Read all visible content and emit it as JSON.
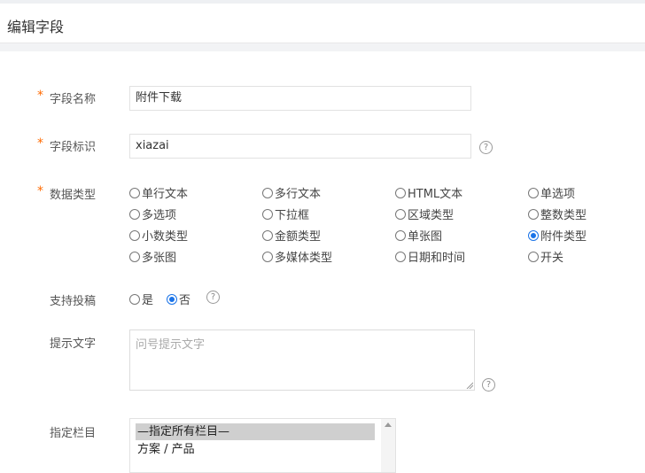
{
  "header": {
    "title": "编辑字段"
  },
  "form": {
    "required_mark": "*",
    "field_name": {
      "label": "字段名称",
      "value": "附件下载"
    },
    "field_key": {
      "label": "字段标识",
      "value": "xiazai"
    },
    "data_type": {
      "label": "数据类型",
      "options": [
        "单行文本",
        "多行文本",
        "HTML文本",
        "单选项",
        "多选项",
        "下拉框",
        "区域类型",
        "整数类型",
        "小数类型",
        "金额类型",
        "单张图",
        "附件类型",
        "多张图",
        "多媒体类型",
        "日期和时间",
        "开关"
      ],
      "selected": "附件类型"
    },
    "allow_submit": {
      "label": "支持投稿",
      "yes": "是",
      "no": "否",
      "selected": "否"
    },
    "hint_text": {
      "label": "提示文字",
      "placeholder": "问号提示文字"
    },
    "columns": {
      "label": "指定栏目",
      "options": [
        "—指定所有栏目—",
        "方案 / 产品"
      ],
      "selected": "—指定所有栏目—"
    }
  },
  "icons": {
    "help": "help-circle-icon",
    "resize": "resize-grip-icon",
    "scroll_up": "scroll-up-arrow-icon"
  },
  "colors": {
    "required": "#ff6a00",
    "radio_selected": "#1a73e8",
    "section_separator": "#f2f3f5"
  }
}
